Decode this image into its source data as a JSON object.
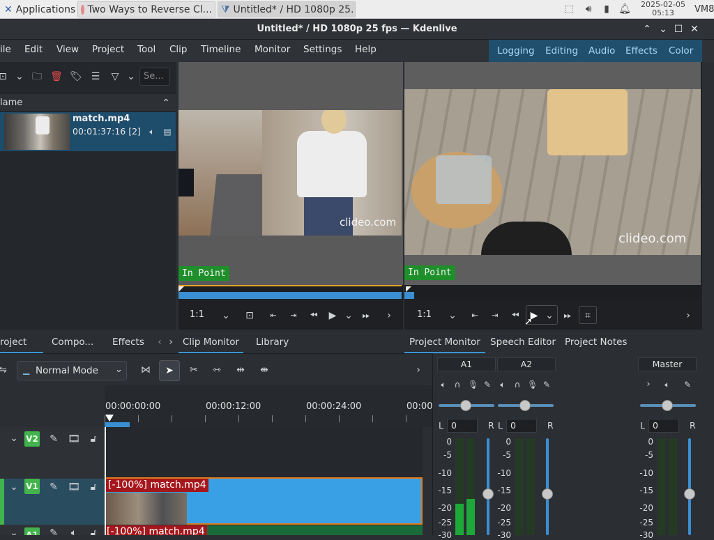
{
  "taskbar": {
    "applications_label": "Applications",
    "task1": "Two Ways to Reverse Cl...",
    "task2": "Untitled* / HD 1080p 25...",
    "date": "2025-02-05",
    "time": "05:13",
    "user": "VM8"
  },
  "window": {
    "title": "Untitled* / HD 1080p 25 fps — Kdenlive"
  },
  "menu": [
    "ile",
    "Edit",
    "View",
    "Project",
    "Tool",
    "Clip",
    "Timeline",
    "Monitor",
    "Settings",
    "Help"
  ],
  "layouts": [
    "Logging",
    "Editing",
    "Audio",
    "Effects",
    "Color"
  ],
  "bin": {
    "search_placeholder": "Se...",
    "column_name": "lame",
    "clip_name": "match.mp4",
    "clip_duration": "00:01:37:16 [2]",
    "tabs": [
      "roject ...",
      "Compo...",
      "Effects"
    ]
  },
  "clip_monitor": {
    "watermark": "clideo.com",
    "in_point": "In Point",
    "zoom": "1:1",
    "tabs": [
      "Clip Monitor",
      "Library"
    ]
  },
  "project_monitor": {
    "watermark": "clideo.com",
    "in_point": "In Point",
    "zoom": "1:1",
    "tabs": [
      "Project Monitor",
      "Speech Editor",
      "Project Notes"
    ]
  },
  "timeline": {
    "mode": "Normal Mode",
    "timecodes": [
      "00:00:00:00",
      "00:00:12:00",
      "00:00:24:00",
      "00:00:"
    ],
    "tracks": {
      "v2": "V2",
      "v1": "V1",
      "a1": "A1"
    },
    "clip_v1": "[-100%] match.mp4",
    "clip_a1": "[-100%] match.mp4"
  },
  "mixer": {
    "channels": [
      {
        "name": "A1",
        "balance_l": "L",
        "balance_value": "0",
        "balance_r": "R"
      },
      {
        "name": "A2",
        "balance_l": "L",
        "balance_value": "0",
        "balance_r": "R"
      },
      {
        "name": "Master",
        "balance_l": "L",
        "balance_value": "0",
        "balance_r": "R"
      }
    ],
    "scale": [
      "0",
      "-5",
      "-10",
      "-15",
      "-20",
      "-25",
      "-30"
    ]
  },
  "colors": {
    "accent": "#3a8fd2",
    "in_point_green": "#1e8f2a",
    "track_badge": "#43b34d",
    "clip_label_red": "#a5171c",
    "layout_bar": "#1f4f6d"
  }
}
